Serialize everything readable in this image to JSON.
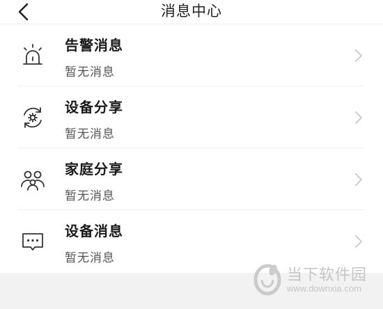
{
  "header": {
    "title": "消息中心",
    "back_icon": "chevron-left-icon"
  },
  "messages": [
    {
      "icon": "alarm-siren-icon",
      "title": "告警消息",
      "status": "暂无消息"
    },
    {
      "icon": "device-share-icon",
      "title": "设备分享",
      "status": "暂无消息"
    },
    {
      "icon": "family-share-icon",
      "title": "家庭分享",
      "status": "暂无消息"
    },
    {
      "icon": "chat-bubble-icon",
      "title": "设备消息",
      "status": "暂无消息"
    }
  ],
  "watermark": {
    "name": "当下软件园",
    "url": "www.downxia.com"
  },
  "colors": {
    "background": "#f2f2f2",
    "surface": "#ffffff",
    "text_primary": "#1a1a1a",
    "text_secondary": "#555555",
    "chevron": "#c8c8c8"
  }
}
